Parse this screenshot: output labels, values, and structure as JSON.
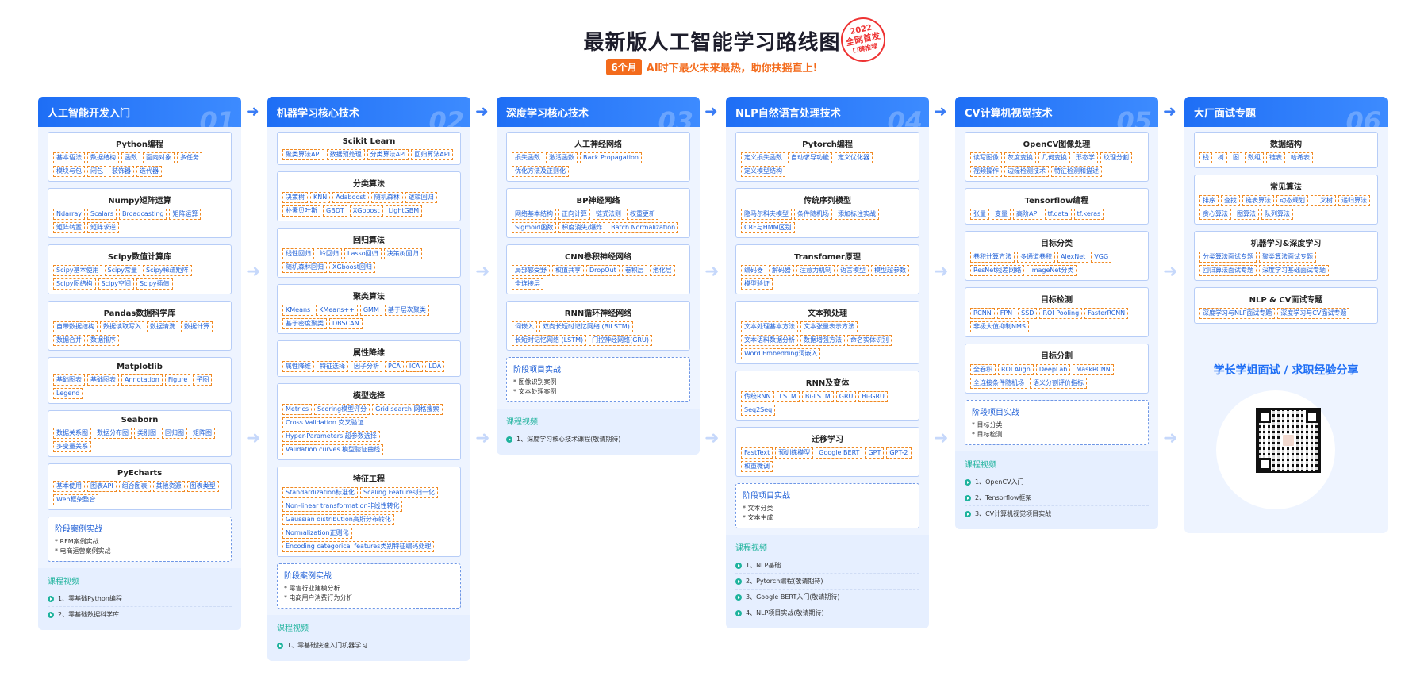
{
  "header": {
    "title": "最新版人工智能学习路线图",
    "stamp": [
      "2022",
      "全网首发",
      "口碑推荐"
    ],
    "badge": "6个月",
    "slogan": "AI时下最火未来最热，助你扶摇直上!"
  },
  "columns": [
    {
      "title": "人工智能开发入门",
      "num": "01",
      "cards": [
        {
          "title": "Python编程",
          "tags": [
            "基本语法",
            "数据结构",
            "函数",
            "面向对象",
            "多任务",
            "模块与包",
            "闭包",
            "装饰器",
            "迭代器"
          ]
        },
        {
          "title": "Numpy矩阵运算",
          "tags": [
            "Ndarray",
            "Scalars",
            "Broadcasting",
            "矩阵运算",
            "矩阵转置",
            "矩阵求逆"
          ]
        },
        {
          "title": "Scipy数值计算库",
          "tags": [
            "Scipy基本使用",
            "Scipy常量",
            "Scipy稀疏矩阵",
            "Scipy图结构",
            "Scipy空间",
            "Scipy插值"
          ]
        },
        {
          "title": "Pandas数据科学库",
          "tags": [
            "自带数据结构",
            "数据读取写入",
            "数据清洗",
            "数据计算",
            "数据合并",
            "数据排序"
          ]
        },
        {
          "title": "Matplotlib",
          "tags": [
            "基础图表",
            "基础图表",
            "Annotation",
            "Figure",
            "子图",
            "Legend"
          ]
        },
        {
          "title": "Seaborn",
          "tags": [
            "数据关系图",
            "数据分布图",
            "类别图",
            "回归图",
            "矩阵图",
            "多变量关系"
          ]
        },
        {
          "title": "PyEcharts",
          "tags": [
            "基本使用",
            "图表API",
            "组合图表",
            "其他资源",
            "图表类型",
            "Web框架整合"
          ]
        }
      ],
      "practice": {
        "title": "阶段案例实战",
        "items": [
          "RFM案例实战",
          "电商运营案例实战"
        ]
      },
      "courses": {
        "title": "课程视频",
        "items": [
          "1、零基础Python编程",
          "2、零基础数据科学库"
        ]
      }
    },
    {
      "title": "机器学习核心技术",
      "num": "02",
      "cards": [
        {
          "title": "Scikit Learn",
          "tags": [
            "聚类算法API",
            "数据预处理",
            "分类算法API",
            "回归算法API"
          ]
        },
        {
          "title": "分类算法",
          "tags": [
            "决策树",
            "KNN",
            "Adaboost",
            "随机森林",
            "逻辑回归",
            "朴素贝叶斯",
            "GBDT",
            "XGboost",
            "LightGBM"
          ]
        },
        {
          "title": "回归算法",
          "tags": [
            "线性回归",
            "岭回归",
            "Lasso回归",
            "决策树回归",
            "随机森林回归",
            "XGboost回归"
          ]
        },
        {
          "title": "聚类算法",
          "tags": [
            "KMeans",
            "KMeans++",
            "GMM",
            "基于层次聚类",
            "基于密度聚类",
            "DBSCAN"
          ]
        },
        {
          "title": "属性降维",
          "tags": [
            "属性降维",
            "特征选择",
            "因子分析",
            "PCA",
            "ICA",
            "LDA"
          ]
        },
        {
          "title": "模型选择",
          "tags": [
            "Metrics",
            "Scoring模型评分",
            "Grid search 网格搜索",
            "Cross Validation 交叉验证",
            "Hyper-Parameters 超参数选择",
            "Validation curves 模型验证曲线"
          ]
        },
        {
          "title": "特征工程",
          "tags": [
            "Standardization标准化",
            "Scaling Features归一化",
            "Non-linear transformation非线性转化",
            "Gaussian distribution高斯分布转化",
            "Normalization正则化",
            "Encoding categorical features类别特征编码处理"
          ]
        }
      ],
      "practice": {
        "title": "阶段案例实战",
        "items": [
          "零售行业建模分析",
          "电商用户消费行为分析"
        ]
      },
      "courses": {
        "title": "课程视频",
        "items": [
          "1、零基础快速入门机器学习"
        ]
      }
    },
    {
      "title": "深度学习核心技术",
      "num": "03",
      "cards": [
        {
          "title": "人工神经网络",
          "tags": [
            "损失函数",
            "激活函数",
            "Back Propagation",
            "优化方法及正则化"
          ]
        },
        {
          "title": "BP神经网络",
          "tags": [
            "网络基本结构",
            "正向计算",
            "链式法则",
            "权重更新",
            "Sigmoid函数",
            "梯度消失/爆炸",
            "Batch Normalization"
          ]
        },
        {
          "title": "CNN卷积神经网络",
          "tags": [
            "局部感受野",
            "权值共享",
            "DropOut",
            "卷积层",
            "池化层",
            "全连接层"
          ]
        },
        {
          "title": "RNN循环神经网络",
          "tags": [
            "词嵌入",
            "双向长短时记忆网络 (BiLSTM)",
            "长短时记忆网络 (LSTM)",
            "门控神经网络(GRU)"
          ]
        }
      ],
      "practice": {
        "title": "阶段项目实战",
        "items": [
          "图像识别案例",
          "文本处理案例"
        ]
      },
      "courses": {
        "title": "课程视频",
        "items": [
          "1、深度学习核心技术课程(敬请期待)"
        ]
      }
    },
    {
      "title": "NLP自然语言处理技术",
      "num": "04",
      "cards": [
        {
          "title": "Pytorch编程",
          "tags": [
            "定义损失函数",
            "自动求导功能",
            "定义优化器",
            "定义模型结构"
          ]
        },
        {
          "title": "传统序列模型",
          "tags": [
            "隐马尔科夫模型",
            "条件随机场",
            "添加标注实战",
            "CRF与HMM区别"
          ]
        },
        {
          "title": "Transfomer原理",
          "tags": [
            "编码器",
            "解码器",
            "注意力机制",
            "语言模型",
            "模型超参数",
            "模型验证"
          ]
        },
        {
          "title": "文本预处理",
          "tags": [
            "文本处理基本方法",
            "文本张量表示方法",
            "文本语料数据分析",
            "数据增强方法",
            "命名实体识别",
            "Word Embedding词嵌入"
          ]
        },
        {
          "title": "RNN及变体",
          "tags": [
            "传统RNN",
            "LSTM",
            "Bi-LSTM",
            "GRU",
            "Bi-GRU",
            "Seq2Seq"
          ]
        },
        {
          "title": "迁移学习",
          "tags": [
            "FastText",
            "预训练模型",
            "Google BERT",
            "GPT",
            "GPT-2",
            "权重微调"
          ]
        }
      ],
      "practice": {
        "title": "阶段项目实战",
        "items": [
          "文本分类",
          "文本生成"
        ]
      },
      "courses": {
        "title": "课程视频",
        "items": [
          "1、NLP基础",
          "2、Pytorch编程(敬请期待)",
          "3、Google BERT入门(敬请期待)",
          "4、NLP项目实战(敬请期待)"
        ]
      }
    },
    {
      "title": "CV计算机视觉技术",
      "num": "05",
      "cards": [
        {
          "title": "OpenCV图像处理",
          "tags": [
            "读写图像",
            "灰度变换",
            "几何变换",
            "形态学",
            "纹理分割",
            "视频操作",
            "边缘检测技术",
            "特征检测和描述"
          ]
        },
        {
          "title": "Tensorflow编程",
          "tags": [
            "张量",
            "变量",
            "高阶API",
            "tf.data",
            "tf.keras"
          ]
        },
        {
          "title": "目标分类",
          "tags": [
            "卷积计算方法",
            "多通道卷积",
            "AlexNet",
            "VGG",
            "ResNet残差网络",
            "ImageNet分类"
          ]
        },
        {
          "title": "目标检测",
          "tags": [
            "RCNN",
            "FPN",
            "SSD",
            "ROI Pooling",
            "FasterRCNN",
            "非极大值抑制NMS"
          ]
        },
        {
          "title": "目标分割",
          "tags": [
            "全卷积",
            "ROI Align",
            "DeepLab",
            "MaskRCNN",
            "全连接条件随机场",
            "语义分割评价指标"
          ]
        }
      ],
      "practice": {
        "title": "阶段项目实战",
        "items": [
          "目标分类",
          "目标检测"
        ]
      },
      "courses": {
        "title": "课程视频",
        "items": [
          "1、OpenCV入门",
          "2、Tensorflow框架",
          "3、CV计算机视觉项目实战"
        ]
      }
    },
    {
      "title": "大厂面试专题",
      "num": "06",
      "cards": [
        {
          "title": "数据结构",
          "tags": [
            "栈",
            "树",
            "图",
            "数组",
            "链表",
            "哈希表"
          ]
        },
        {
          "title": "常见算法",
          "tags": [
            "排序",
            "查找",
            "链表算法",
            "动态规划",
            "二叉树",
            "递归算法",
            "贪心算法",
            "图算法",
            "队列算法"
          ]
        },
        {
          "title": "机器学习&深度学习",
          "tags": [
            "分类算法面试专题",
            "聚类算法面试专题",
            "回归算法面试专题",
            "深度学习基础面试专题"
          ]
        },
        {
          "title": "NLP & CV面试专题",
          "tags": [
            "深度学习与NLP面试专题",
            "深度学习与CV面试专题"
          ]
        }
      ],
      "share": "学长学姐面试 / 求职经验分享"
    }
  ]
}
